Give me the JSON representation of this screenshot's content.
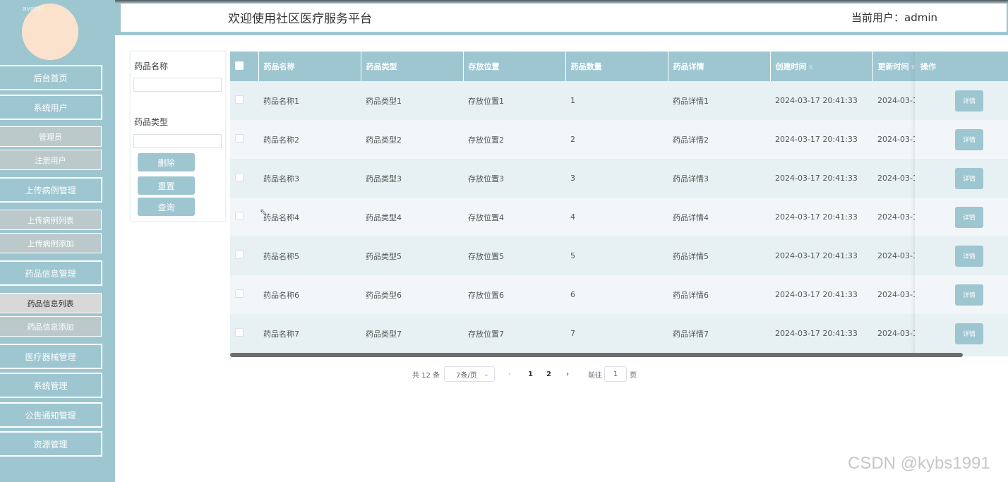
{
  "header": {
    "title": "欢迎使用社区医疗服务平台",
    "user": "当前用户：admin"
  },
  "sidebar": {
    "avatar_alt": "avatar",
    "items": [
      {
        "label": "后台首页",
        "type": "main"
      },
      {
        "label": "系统用户",
        "type": "main"
      },
      {
        "label": "管理员",
        "type": "sub"
      },
      {
        "label": "注册用户",
        "type": "sub"
      },
      {
        "label": "上传病例管理",
        "type": "main"
      },
      {
        "label": "上传病例列表",
        "type": "sub"
      },
      {
        "label": "上传病例添加",
        "type": "sub"
      },
      {
        "label": "药品信息管理",
        "type": "main"
      },
      {
        "label": "药品信息列表",
        "type": "sub",
        "active": true
      },
      {
        "label": "药品信息添加",
        "type": "sub"
      },
      {
        "label": "医疗器械管理",
        "type": "main"
      },
      {
        "label": "系统管理",
        "type": "main"
      },
      {
        "label": "公告通知管理",
        "type": "main"
      },
      {
        "label": "资源管理",
        "type": "main"
      }
    ]
  },
  "search": {
    "name_label": "药品名称",
    "type_label": "药品类型",
    "name_value": "",
    "type_value": "",
    "delete_label": "删除",
    "reset_label": "重置",
    "query_label": "查询"
  },
  "table": {
    "columns": [
      "药品名称",
      "药品类型",
      "存放位置",
      "药品数量",
      "药品详情",
      "创建时间",
      "更新时间",
      "操作"
    ],
    "rows": [
      {
        "name": "药品名称1",
        "type": "药品类型1",
        "location": "存放位置1",
        "qty": "1",
        "detail": "药品详情1",
        "created": "2024-03-17 20:41:33",
        "updated": "2024-03-1"
      },
      {
        "name": "药品名称2",
        "type": "药品类型2",
        "location": "存放位置2",
        "qty": "2",
        "detail": "药品详情2",
        "created": "2024-03-17 20:41:33",
        "updated": "2024-03-1"
      },
      {
        "name": "药品名称3",
        "type": "药品类型3",
        "location": "存放位置3",
        "qty": "3",
        "detail": "药品详情3",
        "created": "2024-03-17 20:41:33",
        "updated": "2024-03-1"
      },
      {
        "name": "药品名称4",
        "type": "药品类型4",
        "location": "存放位置4",
        "qty": "4",
        "detail": "药品详情4",
        "created": "2024-03-17 20:41:33",
        "updated": "2024-03-1"
      },
      {
        "name": "药品名称5",
        "type": "药品类型5",
        "location": "存放位置5",
        "qty": "5",
        "detail": "药品详情5",
        "created": "2024-03-17 20:41:33",
        "updated": "2024-03-1"
      },
      {
        "name": "药品名称6",
        "type": "药品类型6",
        "location": "存放位置6",
        "qty": "6",
        "detail": "药品详情6",
        "created": "2024-03-17 20:41:33",
        "updated": "2024-03-1"
      },
      {
        "name": "药品名称7",
        "type": "药品类型7",
        "location": "存放位置7",
        "qty": "7",
        "detail": "药品详情7",
        "created": "2024-03-17 20:41:33",
        "updated": "2024-03-1"
      }
    ],
    "detail_button": "详情"
  },
  "pagination": {
    "total": "共 12 条",
    "page_size": "7条/页",
    "pages": [
      "1",
      "2"
    ],
    "goto_label": "前往",
    "goto_value": "1",
    "page_suffix": "页"
  },
  "watermark": "CSDN @kybs1991",
  "colors": {
    "accent": "#9dc6d1",
    "row_even": "#f2f6f8",
    "row_odd": "#e7f0f2"
  }
}
